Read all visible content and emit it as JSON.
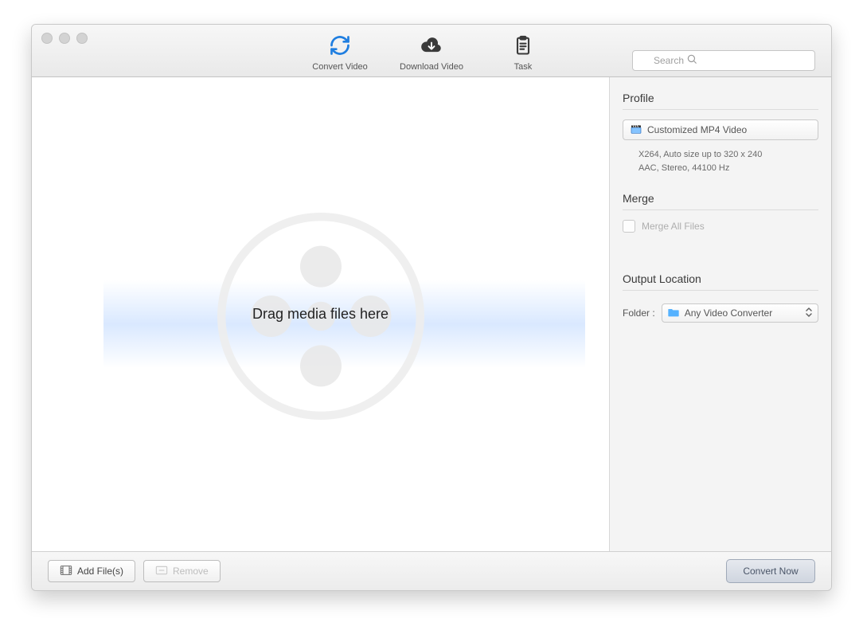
{
  "toolbar": {
    "tabs": [
      {
        "label": "Convert Video"
      },
      {
        "label": "Download Video"
      },
      {
        "label": "Task"
      }
    ],
    "search_placeholder": "Search"
  },
  "drop_area": {
    "hint": "Drag media files here"
  },
  "sidebar": {
    "profile": {
      "title": "Profile",
      "selected": "Customized MP4 Video",
      "detail_line1": "X264, Auto size up to 320 x 240",
      "detail_line2": "AAC, Stereo, 44100 Hz"
    },
    "merge": {
      "title": "Merge",
      "checkbox_label": "Merge All Files"
    },
    "output": {
      "title": "Output Location",
      "folder_label": "Folder :",
      "folder_value": "Any Video Converter"
    }
  },
  "footer": {
    "add_label": "Add File(s)",
    "remove_label": "Remove",
    "convert_label": "Convert Now"
  },
  "colors": {
    "accent_blue": "#1f7ee0",
    "toolbar_icon_dark": "#3a3a3a"
  }
}
